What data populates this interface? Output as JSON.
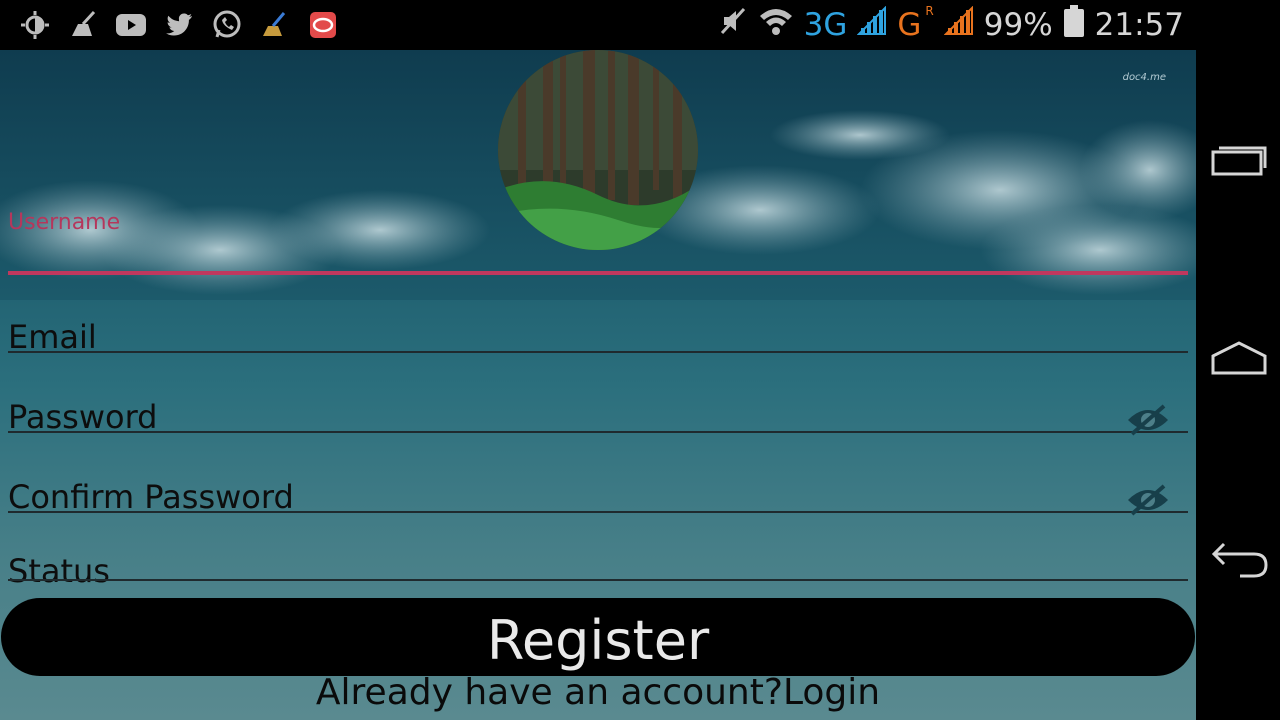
{
  "status_bar": {
    "left_icons": [
      "brightness-icon",
      "broom-icon",
      "youtube-icon",
      "twitter-icon",
      "whatsapp-icon",
      "cleaner-icon",
      "app-icon"
    ],
    "network_3g": "3G",
    "network_g": "G",
    "roaming": "R",
    "battery": "99%",
    "time": "21:57"
  },
  "header": {
    "watermark": "doc4.me"
  },
  "form": {
    "username_label": "Username",
    "email_label": "Email",
    "password_label": "Password",
    "confirm_password_label": "Confirm Password",
    "status_label": "Status",
    "register_label": "Register",
    "login_prompt": "Already have an account?Login"
  },
  "colors": {
    "accent": "#c0385e",
    "button_bg": "#000000"
  }
}
